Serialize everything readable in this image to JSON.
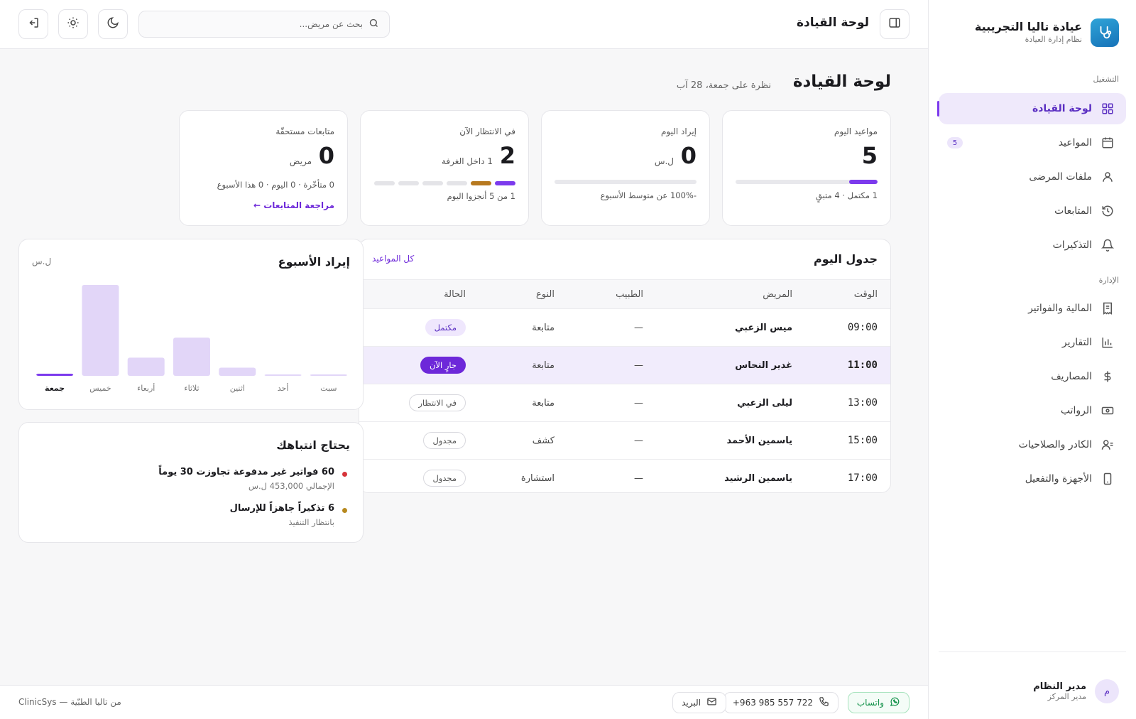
{
  "brand": {
    "name": "عيادة تاليا التجريبية",
    "subtitle": "نظام إدارة العيادة"
  },
  "sidebar": {
    "section_ops": "التشغيل",
    "section_admin": "الإدارة",
    "items": [
      {
        "label": "لوحة القيادة",
        "icon": "grid-icon",
        "active": true
      },
      {
        "label": "المواعيد",
        "icon": "calendar-icon",
        "badge": "5"
      },
      {
        "label": "ملفات المرضى",
        "icon": "user-icon"
      },
      {
        "label": "المتابعات",
        "icon": "history-icon"
      },
      {
        "label": "التذكيرات",
        "icon": "bell-icon"
      },
      {
        "label": "المالية والفواتير",
        "icon": "receipt-icon"
      },
      {
        "label": "التقارير",
        "icon": "bar-chart-icon"
      },
      {
        "label": "المصاريف",
        "icon": "dollar-icon"
      },
      {
        "label": "الرواتب",
        "icon": "banknote-icon"
      },
      {
        "label": "الكادر والصلاحيات",
        "icon": "users-icon"
      },
      {
        "label": "الأجهزة والتفعيل",
        "icon": "device-icon"
      }
    ],
    "user": {
      "initial": "م",
      "name": "مدير النظام",
      "role": "مدير المركز"
    }
  },
  "topbar": {
    "title": "لوحة القيادة",
    "search_placeholder": "بحث عن مريض..."
  },
  "page": {
    "title": "لوحة القيادة",
    "subtitle": "نظرة على جمعة، 28 آب"
  },
  "stats": {
    "appointments": {
      "label": "مواعيد اليوم",
      "value": "5",
      "foot": "1 مكتمل · 4 متبقٍ",
      "progress": 0.2
    },
    "revenue": {
      "label": "إيراد اليوم",
      "value": "0",
      "unit": "ل.س",
      "foot": "-100% عن متوسط الأسبوع",
      "progress": 0
    },
    "waiting": {
      "label": "في الانتظار الآن",
      "value": "2",
      "unit": "1 داخل الغرفة",
      "foot": "1 من 5 أنجزوا اليوم",
      "segments": [
        "#7c3aed",
        "#b7791f",
        "#e4e4e8",
        "#e4e4e8",
        "#e4e4e8",
        "#e4e4e8"
      ]
    },
    "followups": {
      "label": "متابعات مستحقّة",
      "value": "0",
      "unit": "مريض",
      "foot": "0 متأخّرة · 0 اليوم · 0 هذا الأسبوع",
      "link": "مراجعة المتابعات ←"
    }
  },
  "schedule": {
    "title": "جدول اليوم",
    "link": "كل المواعيد",
    "columns": [
      "الوقت",
      "المريض",
      "الطبيب",
      "النوع",
      "الحالة"
    ],
    "rows": [
      {
        "time": "09:00",
        "patient": "ميس الزعبي",
        "doctor": "—",
        "type": "متابعة",
        "status": "مكتمل",
        "kind": "done"
      },
      {
        "time": "11:00",
        "patient": "غدير النحاس",
        "doctor": "—",
        "type": "متابعة",
        "status": "جارٍ الآن",
        "kind": "now"
      },
      {
        "time": "13:00",
        "patient": "ليلى الزعبي",
        "doctor": "—",
        "type": "متابعة",
        "status": "في الانتظار",
        "kind": "wait"
      },
      {
        "time": "15:00",
        "patient": "ياسمين الأحمد",
        "doctor": "—",
        "type": "كشف",
        "status": "مجدول",
        "kind": "sched"
      },
      {
        "time": "17:00",
        "patient": "ياسمين الرشيد",
        "doctor": "—",
        "type": "استشارة",
        "status": "مجدول",
        "kind": "sched"
      }
    ]
  },
  "chart_data": {
    "type": "bar",
    "title": "إيراد الأسبوع",
    "ylabel": "ل.س",
    "categories": [
      "جمعة",
      "خميس",
      "أربعاء",
      "ثلاثاء",
      "اثنين",
      "أحد",
      "سبت"
    ],
    "values": [
      0,
      100,
      20,
      42,
      9,
      1,
      1
    ],
    "highlight_category": "جمعة",
    "colors": {
      "bar": "#e2d6f8",
      "highlight": "#7c3aed"
    }
  },
  "attention": {
    "title": "يحتاج انتباهك",
    "items": [
      {
        "main": "60 فواتير غير مدفوعة تجاوزت 30 يوماً",
        "sub": "الإجمالي 453,000 ل.س",
        "color": "#d6343a"
      },
      {
        "main": "6 تذكيراً جاهزاً للإرسال",
        "sub": "بانتظار التنفيذ",
        "color": "#b7891f"
      }
    ]
  },
  "footer": {
    "whatsapp": "واتساب",
    "phone": "+963 985 557 722",
    "email": "البريد",
    "credit": "ClinicSys — من تاليا الطبّية"
  }
}
